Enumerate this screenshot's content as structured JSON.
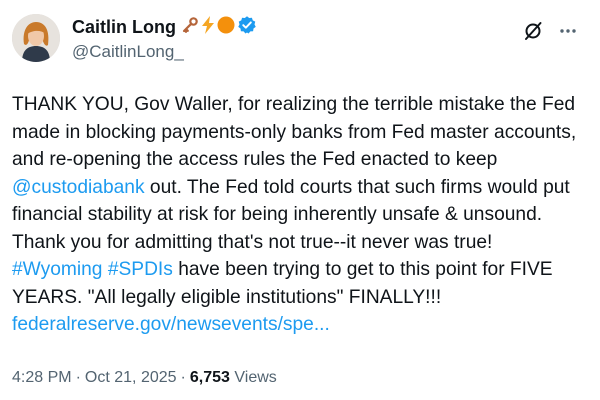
{
  "user": {
    "display_name": "Caitlin Long",
    "handle": "@CaitlinLong_",
    "name_icons": [
      "key-icon",
      "lightning-icon",
      "orange-circle-icon",
      "verified-badge-icon"
    ]
  },
  "actions": {
    "grok_icon": "grok-icon",
    "more_icon": "more-icon"
  },
  "tweet": {
    "p1": "THANK YOU, Gov Waller, for realizing the terrible mistake the Fed made in blocking payments-only banks from Fed master accounts, and re-opening the access rules the Fed enacted to keep ",
    "mention": "@custodiabank",
    "p2": " out. The Fed told courts that such firms would put financial stability at risk for being inherently unsafe & unsound. Thank you for admitting that's not true--it never was true! ",
    "hashtag1": "#Wyoming",
    "space": " ",
    "hashtag2": "#SPDIs",
    "p3": " have been trying to get to this point for FIVE YEARS. \"All legally eligible institutions\" FINALLY!!! ",
    "link": "federalreserve.gov/newsevents/spe..."
  },
  "meta": {
    "time": "4:28 PM",
    "sep": "·",
    "date": "Oct 21, 2025",
    "views_count": "6,753",
    "views_label": "Views"
  },
  "colors": {
    "text": "#0f1419",
    "secondary": "#536471",
    "link": "#1d9bf0",
    "verified": "#1d9bf0",
    "lightning": "#f5a623",
    "orange_circle": "#f4900c",
    "key": "#b5653a"
  }
}
